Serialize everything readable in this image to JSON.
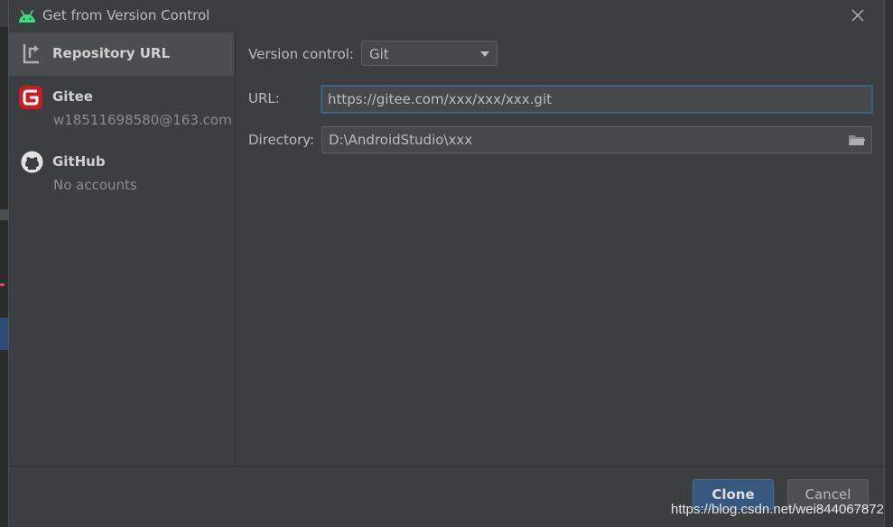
{
  "window": {
    "title": "Get from Version Control"
  },
  "sidebar": {
    "items": [
      {
        "label": "Repository URL",
        "icon": "vcs-arrow-icon"
      },
      {
        "label": "Gitee",
        "sub": "w18511698580@163.com",
        "icon": "gitee-logo-icon"
      },
      {
        "label": "GitHub",
        "sub": "No accounts",
        "icon": "github-logo-icon"
      }
    ]
  },
  "form": {
    "version_control_label": "Version control:",
    "version_control_value": "Git",
    "url_label": "URL:",
    "url_value": "https://gitee.com/xxx/xxx/xxx.git",
    "directory_label": "Directory:",
    "directory_value": "D:\\AndroidStudio\\xxx"
  },
  "buttons": {
    "clone": "Clone",
    "cancel": "Cancel"
  },
  "watermark": "https://blog.csdn.net/wei844067872",
  "colors": {
    "accent": "#365880",
    "focus": "#3d6185",
    "dialog_bg": "#3c3f41",
    "gitee_red": "#c71d23",
    "android_green": "#3ddc84"
  }
}
